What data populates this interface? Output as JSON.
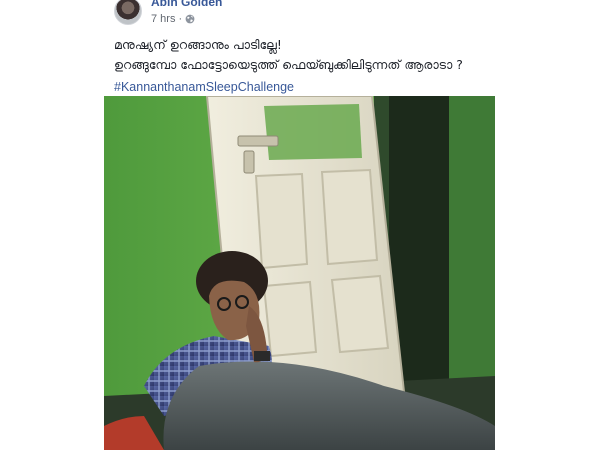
{
  "post": {
    "author": {
      "name": "Abin Golden"
    },
    "time": "7 hrs",
    "separator": "·",
    "privacy_icon": "globe-icon",
    "lines": [
      "മനുഷ്യന് ഉറങ്ങാനും പാടില്ലേ!",
      "ഉറങ്ങുമ്പോ ഫോട്ടോയെടുത്ത് ഫെയ്ബുക്കിലിടുന്നത് ആരാടാ ?"
    ],
    "hashtag": "#KannanthanamSleepChallenge",
    "colors": {
      "link": "#385898",
      "text": "#1d2129",
      "meta": "#616770",
      "wall": "#5aa544",
      "door": "#e9e6d6"
    }
  }
}
